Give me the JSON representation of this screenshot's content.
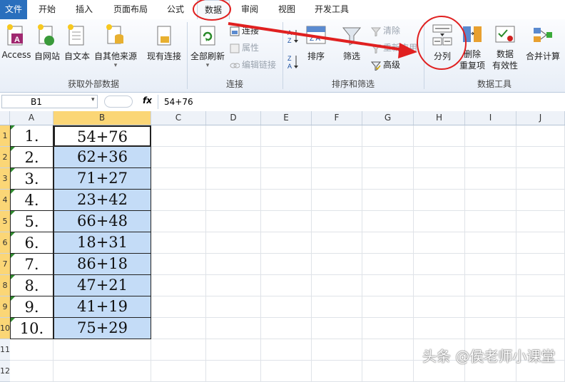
{
  "tabs": [
    "文件",
    "开始",
    "插入",
    "页面布局",
    "公式",
    "数据",
    "审阅",
    "视图",
    "开发工具"
  ],
  "ribbon": {
    "external": {
      "label": "获取外部数据",
      "buttons": [
        "Access",
        "自网站",
        "自文本",
        "自其他来源",
        "现有连接"
      ]
    },
    "connections": {
      "label": "连接",
      "refresh": "全部刷新",
      "items": [
        "连接",
        "属性",
        "编辑链接"
      ]
    },
    "sort_filter": {
      "label": "排序和筛选",
      "sort": "排序",
      "filter": "筛选",
      "items": [
        "清除",
        "重新应用",
        "高级"
      ]
    },
    "tools": {
      "label": "数据工具",
      "split": "分列",
      "remove_dup": [
        "删除",
        "重复项"
      ],
      "validation": [
        "数据",
        "有效性"
      ],
      "consolidate": "合并计算"
    }
  },
  "formula_bar": {
    "name": "B1",
    "fx": "fx",
    "formula": "54+76"
  },
  "columns": [
    "A",
    "B",
    "C",
    "D",
    "E",
    "F",
    "G",
    "H",
    "I",
    "J"
  ],
  "rows": [
    {
      "n": "1",
      "a": "1.",
      "b": "54+76"
    },
    {
      "n": "2",
      "a": "2.",
      "b": "62+36"
    },
    {
      "n": "3",
      "a": "3.",
      "b": "71+27"
    },
    {
      "n": "4",
      "a": "4.",
      "b": "23+42"
    },
    {
      "n": "5",
      "a": "5.",
      "b": "66+48"
    },
    {
      "n": "6",
      "a": "6.",
      "b": "18+31"
    },
    {
      "n": "7",
      "a": "7.",
      "b": "86+18"
    },
    {
      "n": "8",
      "a": "8.",
      "b": "47+21"
    },
    {
      "n": "9",
      "a": "9.",
      "b": "41+19"
    },
    {
      "n": "10",
      "a": "10.",
      "b": "75+29"
    },
    {
      "n": "11",
      "a": "",
      "b": ""
    },
    {
      "n": "12",
      "a": "",
      "b": ""
    }
  ],
  "watermark": "头条 @侯老师小课堂",
  "colors": {
    "selection": "#c4dcf7",
    "header_sel": "#fbd676",
    "annotation": "#e02020",
    "file_tab": "#2a6fbd"
  }
}
